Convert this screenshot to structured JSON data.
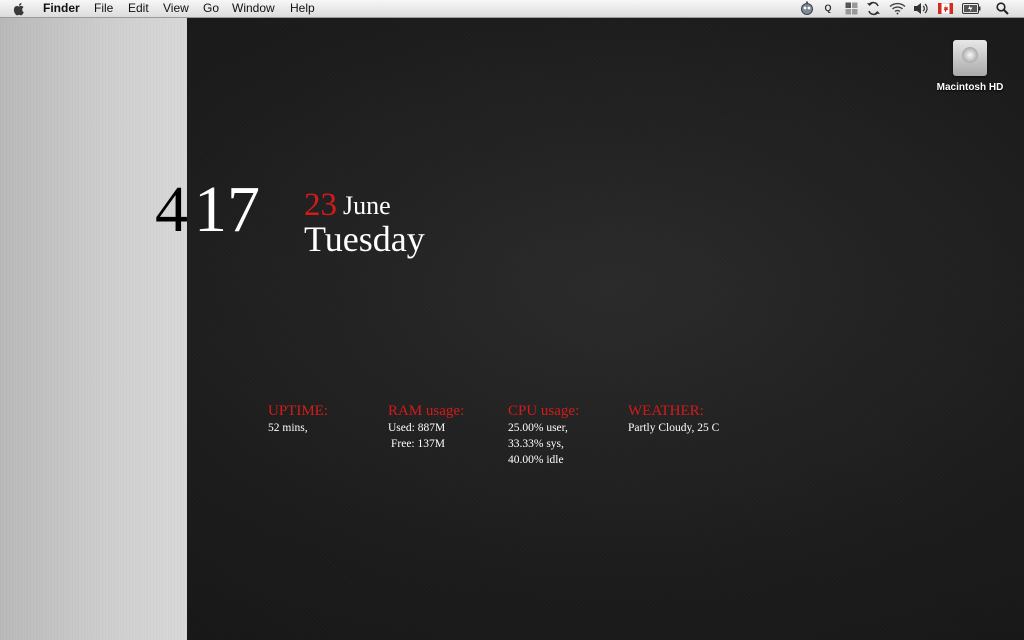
{
  "menubar": {
    "apple_icon": "apple-icon",
    "app_name": "Finder",
    "items": [
      "File",
      "Edit",
      "View",
      "Go",
      "Window",
      "Help"
    ],
    "status_icons": [
      "robot-icon",
      "q-icon",
      "spaces-icon",
      "sync-icon",
      "wifi-icon",
      "volume-icon",
      "flag-icon",
      "battery-icon",
      "spotlight-icon"
    ],
    "q_label": "Q"
  },
  "desktop": {
    "drive_label": "Macintosh HD"
  },
  "clock": {
    "hour": "4",
    "minute": "17"
  },
  "date": {
    "day": "23",
    "month": "June",
    "weekday": "Tuesday"
  },
  "stats": {
    "uptime": {
      "title": "UPTIME:",
      "lines": [
        "52 mins,"
      ]
    },
    "ram": {
      "title": "RAM usage:",
      "lines": [
        "Used: 887M",
        "Free: 137M"
      ]
    },
    "cpu": {
      "title": "CPU usage:",
      "lines": [
        "25.00% user,",
        "33.33% sys,",
        "40.00% idle"
      ]
    },
    "weather": {
      "title": "WEATHER:",
      "lines": [
        "Partly Cloudy, 25 C"
      ]
    }
  },
  "colors": {
    "accent": "#d41b1b",
    "text": "#ffffff",
    "background": "#1c1c1c",
    "panel": "#cfcfcf"
  }
}
